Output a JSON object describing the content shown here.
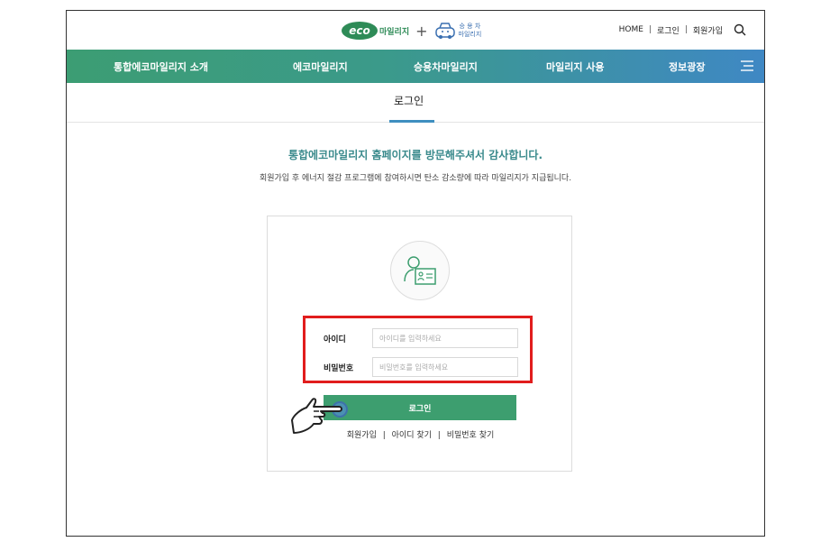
{
  "header": {
    "eco_logo_text": "eco",
    "eco_logo_sub": "마일리지",
    "plus": "+",
    "car_logo_line1": "승 용 차",
    "car_logo_line2": "마일리지",
    "links": [
      {
        "label": "HOME"
      },
      {
        "label": "로그인"
      },
      {
        "label": "회원가입"
      }
    ],
    "separator": "|"
  },
  "nav": {
    "items": [
      {
        "label": "통합에코마일리지 소개"
      },
      {
        "label": "에코마일리지"
      },
      {
        "label": "승용차마일리지"
      },
      {
        "label": "마일리지 사용"
      },
      {
        "label": "정보광장"
      }
    ]
  },
  "page": {
    "tab_title": "로그인",
    "welcome": "통합에코마일리지 홈페이지를 방문해주셔서 감사합니다.",
    "welcome_sub": "회원가입 후 에너지 절감 프로그램에 참여하시면 탄소 감소량에 따라 마일리지가 지급됩니다."
  },
  "login": {
    "id_label": "아이디",
    "id_placeholder": "아이디를 입력하세요",
    "pw_label": "비밀번호",
    "pw_placeholder": "비밀번호를 입력하세요",
    "button_label": "로그인",
    "sub_links": [
      {
        "label": "회원가입"
      },
      {
        "label": "아이디 찾기"
      },
      {
        "label": "비밀번호 찾기"
      }
    ],
    "separator": "|"
  },
  "colors": {
    "nav_start": "#3c9d73",
    "nav_end": "#3f88c4",
    "accent_green": "#3d9e6f",
    "highlight_red": "#e11d1d",
    "tab_underline": "#3f8fc0"
  },
  "icons": {
    "search": "search-icon",
    "menu": "hamburger-menu-icon",
    "user": "user-id-card-icon",
    "hand": "pointing-hand-icon"
  }
}
